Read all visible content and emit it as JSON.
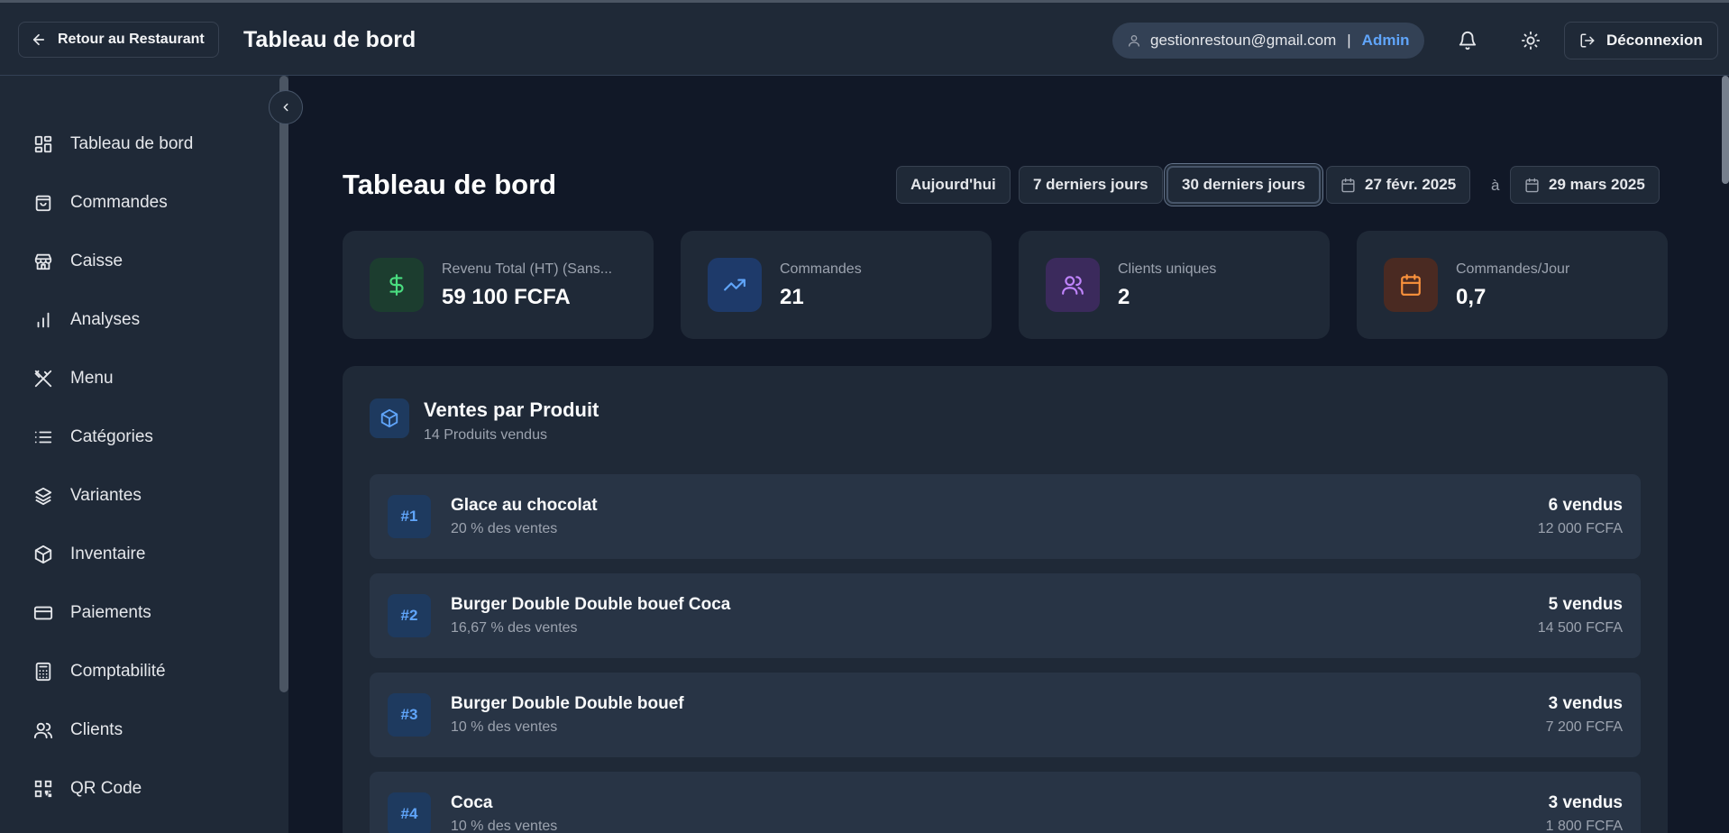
{
  "header": {
    "back_label": "Retour au Restaurant",
    "title": "Tableau de bord",
    "user_email": "gestionrestoun@gmail.com",
    "separator": "|",
    "user_role": "Admin",
    "logout_label": "Déconnexion"
  },
  "sidebar": {
    "items": [
      {
        "label": "Tableau de bord",
        "icon": "layout-dashboard-icon"
      },
      {
        "label": "Commandes",
        "icon": "shopping-bag-icon"
      },
      {
        "label": "Caisse",
        "icon": "store-icon"
      },
      {
        "label": "Analyses",
        "icon": "bar-chart-icon"
      },
      {
        "label": "Menu",
        "icon": "utensils-crossed-icon"
      },
      {
        "label": "Catégories",
        "icon": "list-icon"
      },
      {
        "label": "Variantes",
        "icon": "layers-icon"
      },
      {
        "label": "Inventaire",
        "icon": "package-icon"
      },
      {
        "label": "Paiements",
        "icon": "credit-card-icon"
      },
      {
        "label": "Comptabilité",
        "icon": "calculator-icon"
      },
      {
        "label": "Clients",
        "icon": "users-icon"
      },
      {
        "label": "QR Code",
        "icon": "qr-code-icon"
      }
    ]
  },
  "main": {
    "title": "Tableau de bord",
    "ranges": [
      "Aujourd'hui",
      "7 derniers jours",
      "30 derniers jours"
    ],
    "active_range": "30 derniers jours",
    "date_from": "27 févr. 2025",
    "date_sep": "à",
    "date_to": "29 mars 2025"
  },
  "stats": [
    {
      "label": "Revenu Total (HT) (Sans...",
      "value": "59 100 FCFA",
      "icon": "dollar-sign-icon",
      "color": "#4ade80",
      "bg": "#1c3d2f"
    },
    {
      "label": "Commandes",
      "value": "21",
      "icon": "trending-up-icon",
      "color": "#60a5fa",
      "bg": "#1e3a6a"
    },
    {
      "label": "Clients uniques",
      "value": "2",
      "icon": "users-icon",
      "color": "#c084fc",
      "bg": "#3b2a5c"
    },
    {
      "label": "Commandes/Jour",
      "value": "0,7",
      "icon": "calendar-icon",
      "color": "#fb923c",
      "bg": "#4a2a22"
    }
  ],
  "sales": {
    "title": "Ventes par Produit",
    "subtitle": "14 Produits vendus",
    "products": [
      {
        "rank": "#1",
        "name": "Glace au chocolat",
        "share": "20 % des ventes",
        "qty": "6 vendus",
        "amount": "12 000 FCFA"
      },
      {
        "rank": "#2",
        "name": "Burger Double Double bouef Coca",
        "share": "16,67 % des ventes",
        "qty": "5 vendus",
        "amount": "14 500 FCFA"
      },
      {
        "rank": "#3",
        "name": "Burger Double Double bouef",
        "share": "10 % des ventes",
        "qty": "3 vendus",
        "amount": "7 200 FCFA"
      },
      {
        "rank": "#4",
        "name": "Coca",
        "share": "10 % des ventes",
        "qty": "3 vendus",
        "amount": "1 800 FCFA"
      }
    ]
  }
}
